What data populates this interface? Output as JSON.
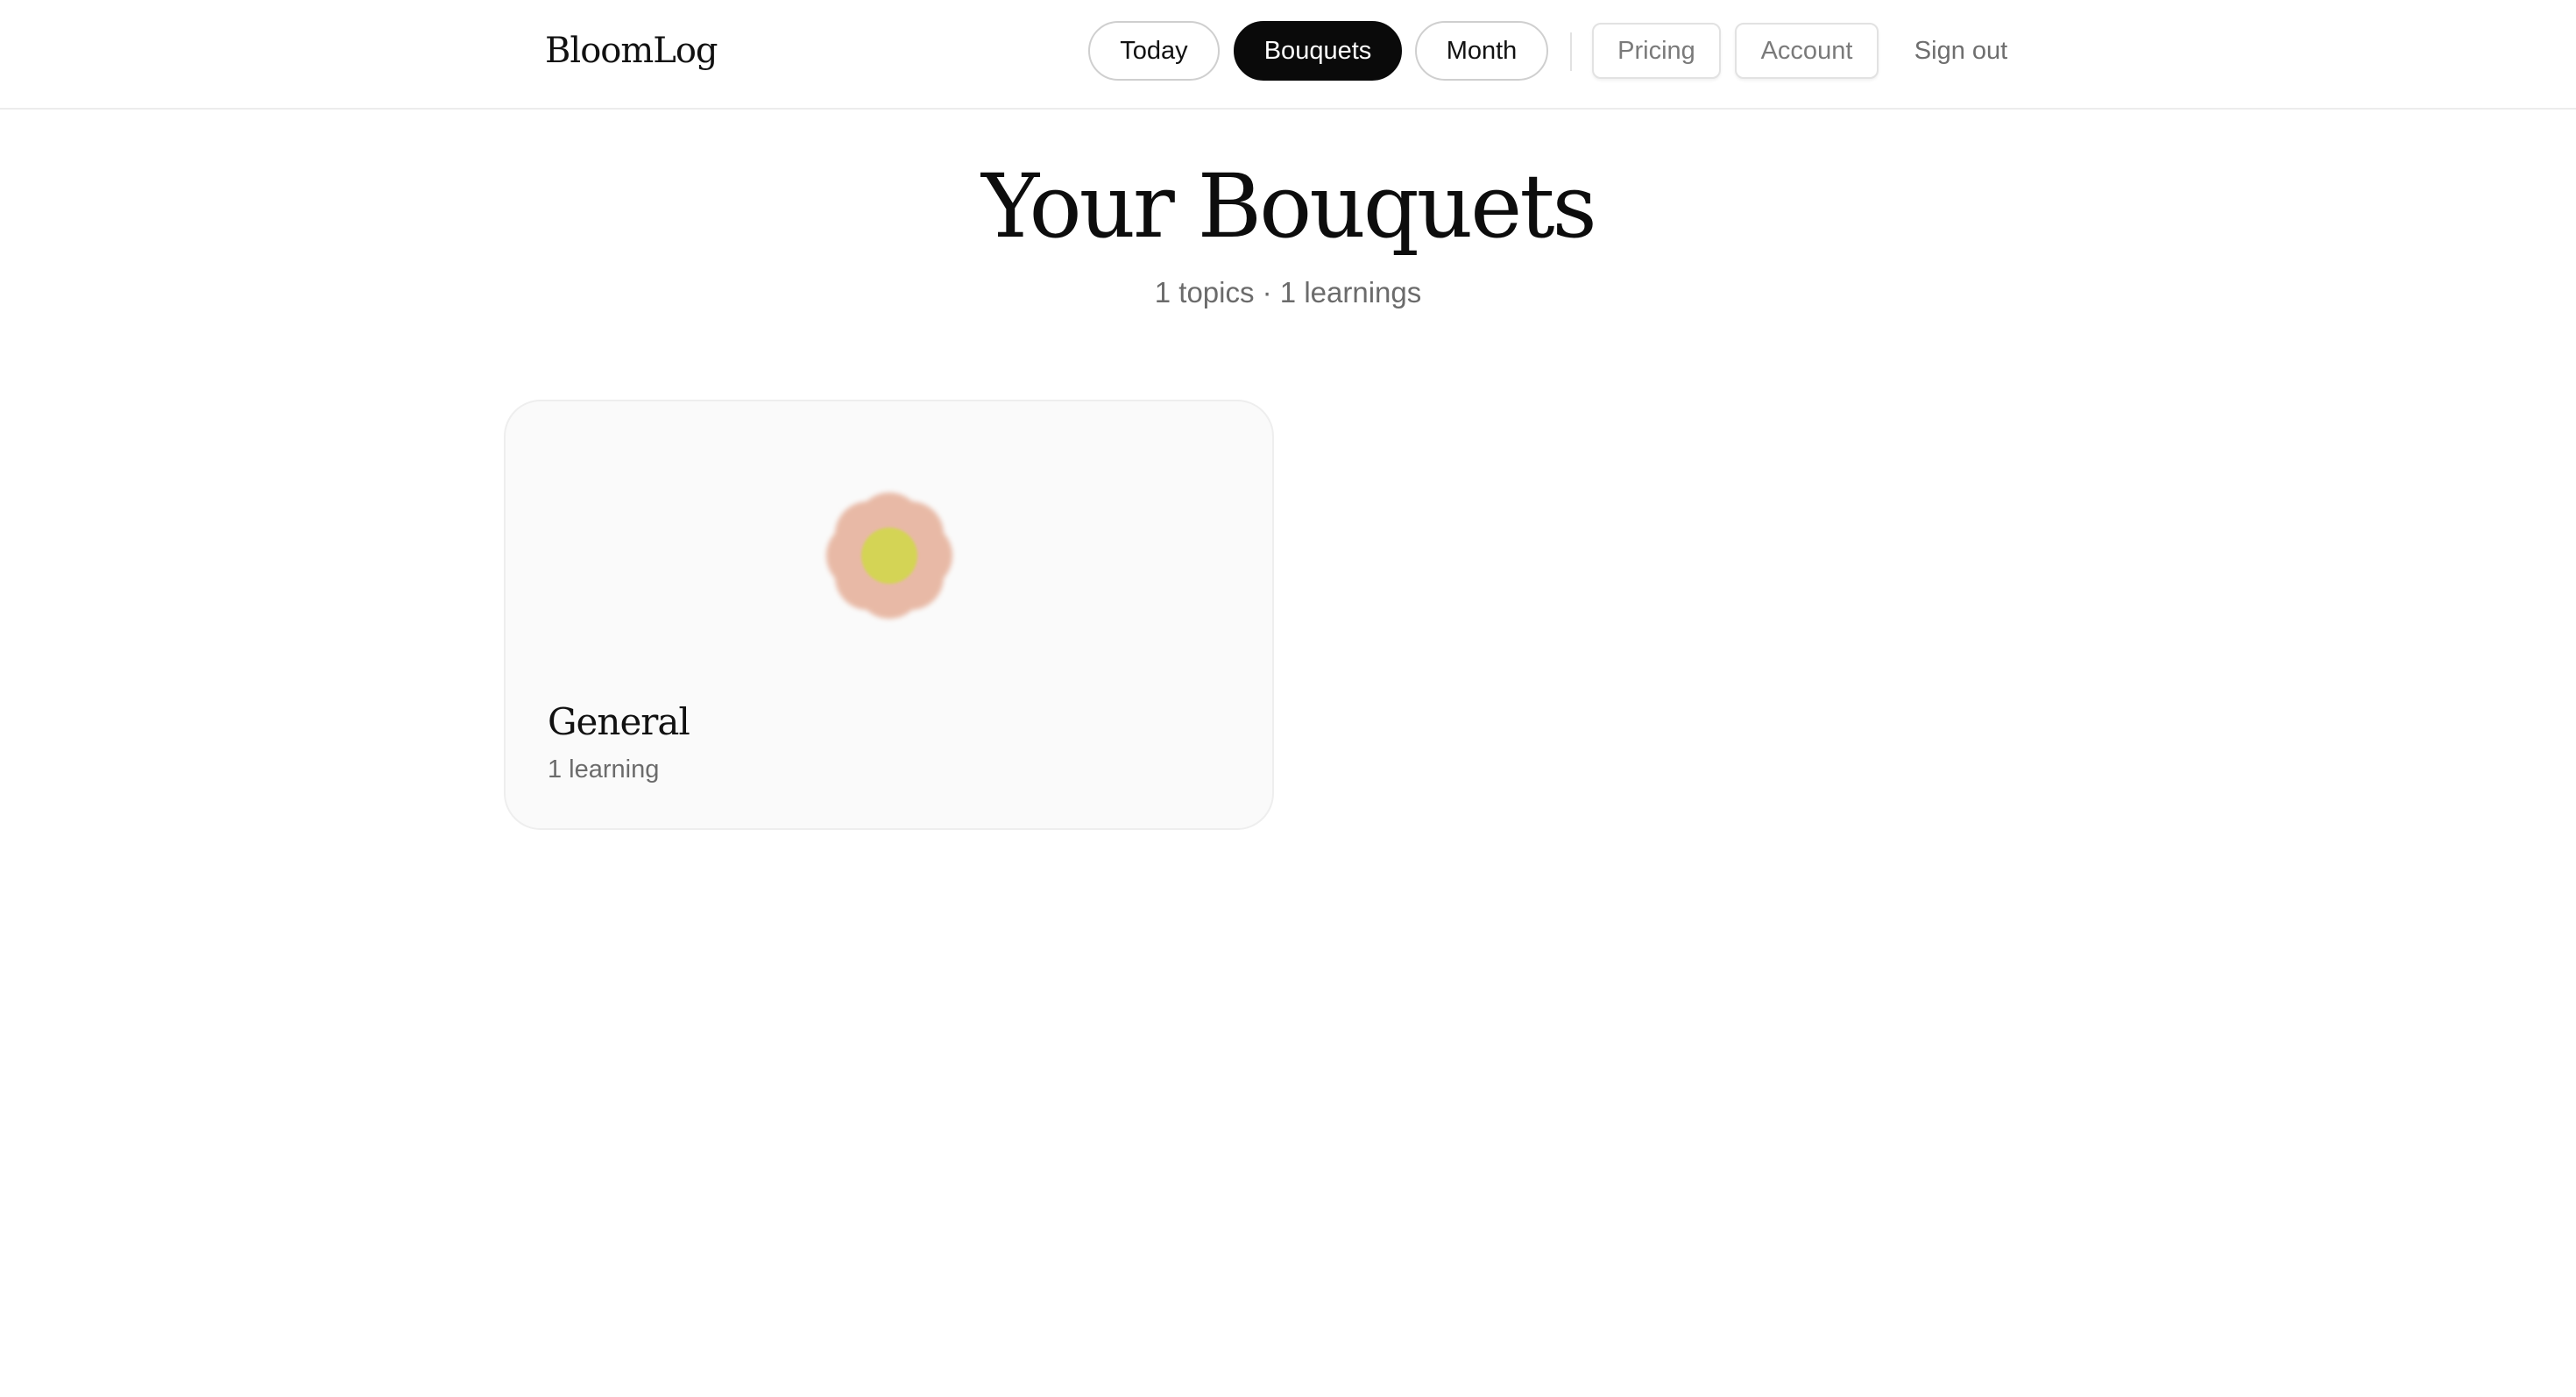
{
  "app": {
    "brand": "BloomLog"
  },
  "nav": {
    "tabs": [
      {
        "label": "Today",
        "active": false
      },
      {
        "label": "Bouquets",
        "active": true
      },
      {
        "label": "Month",
        "active": false
      }
    ],
    "pricing_label": "Pricing",
    "account_label": "Account",
    "signout_label": "Sign out"
  },
  "main": {
    "title": "Your Bouquets",
    "subtitle": "1 topics · 1 learnings",
    "bouquets": [
      {
        "title": "General",
        "count_label": "1 learning",
        "icon": "flower-icon",
        "petal_color": "#e8b9a6",
        "center_color": "#d4d455"
      }
    ]
  },
  "colors": {
    "active_tab_bg": "#0a0a0a",
    "active_tab_text": "#ffffff",
    "card_bg": "#fafafa",
    "muted_text": "#6b6b6b"
  }
}
